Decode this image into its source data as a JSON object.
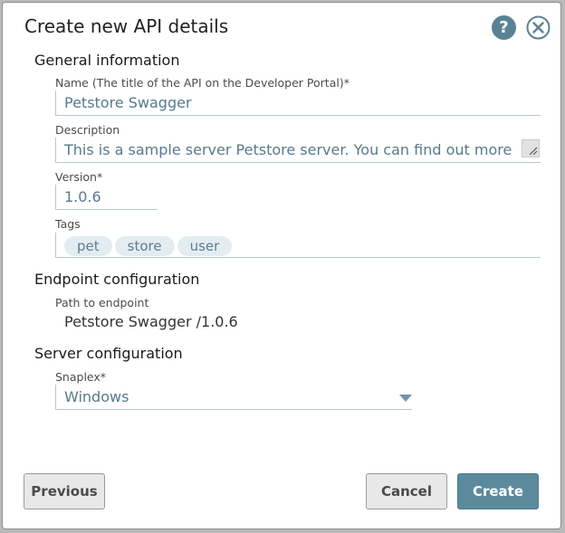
{
  "dialog": {
    "title": "Create new API details",
    "help_icon": "?"
  },
  "general": {
    "heading": "General information",
    "name_label": "Name (The title of the API on the Developer Portal)*",
    "name_value": "Petstore Swagger",
    "description_label": "Description",
    "description_value": "This is a sample server Petstore server.  You can find out more",
    "version_label": "Version*",
    "version_value": "1.0.6",
    "tags_label": "Tags",
    "tags": [
      "pet",
      "store",
      "user"
    ]
  },
  "endpoint": {
    "heading": "Endpoint configuration",
    "path_label": "Path to endpoint",
    "path_value": "Petstore Swagger /1.0.6"
  },
  "server": {
    "heading": "Server configuration",
    "snaplex_label": "Snaplex*",
    "snaplex_value": "Windows"
  },
  "buttons": {
    "previous": "Previous",
    "cancel": "Cancel",
    "create": "Create"
  },
  "icons": {
    "help": "help-icon",
    "close": "close-icon",
    "dropdown": "chevron-down-icon"
  },
  "colors": {
    "accent": "#5a8a9b",
    "field_text": "#577a8b",
    "tag_bg": "#e3edf1"
  }
}
